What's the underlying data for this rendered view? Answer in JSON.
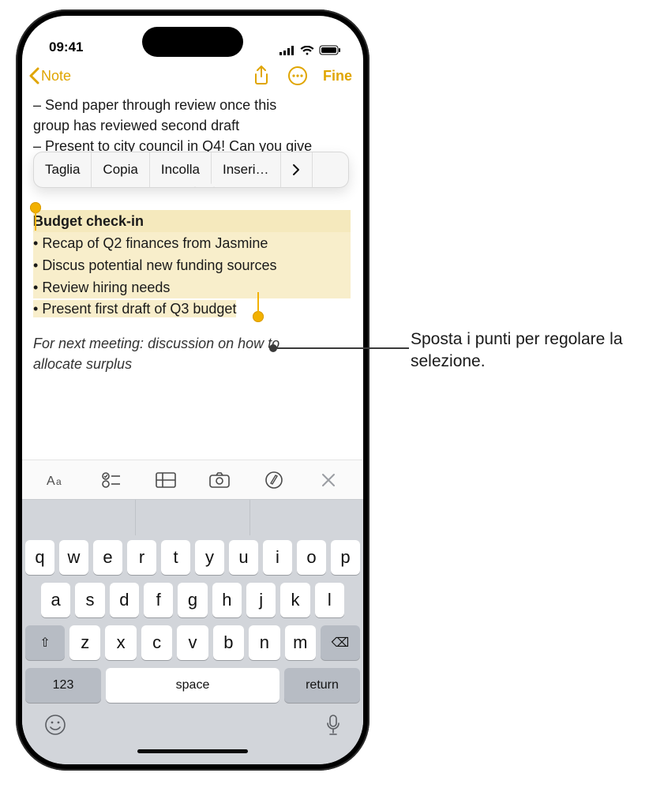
{
  "statusbar": {
    "time": "09:41"
  },
  "navbar": {
    "back_label": "Note",
    "done_label": "Fine"
  },
  "note": {
    "pre_lines": [
      "– Send paper through review once this",
      "group has reviewed second draft",
      "– Present to city council in Q4! Can you give"
    ],
    "selection": {
      "heading": "Budget check-in",
      "items": [
        "Recap of Q2 finances from Jasmine",
        "Discus potential new funding sources",
        "Review hiring needs",
        "Present first draft of Q3 budget"
      ]
    },
    "post_italic": [
      "For next meeting: discussion on how to",
      "allocate surplus"
    ]
  },
  "edit_menu": {
    "items": [
      "Taglia",
      "Copia",
      "Incolla",
      "Inseri…"
    ]
  },
  "kb_toolbar": {
    "icons": [
      "text-format",
      "checklist",
      "table",
      "camera",
      "markup",
      "close"
    ]
  },
  "keyboard": {
    "row1": [
      "q",
      "w",
      "e",
      "r",
      "t",
      "y",
      "u",
      "i",
      "o",
      "p"
    ],
    "row2": [
      "a",
      "s",
      "d",
      "f",
      "g",
      "h",
      "j",
      "k",
      "l"
    ],
    "row3": [
      "z",
      "x",
      "c",
      "v",
      "b",
      "n",
      "m"
    ],
    "shift_label": "⇧",
    "backspace_label": "⌫",
    "num_label": "123",
    "space_label": "space",
    "return_label": "return"
  },
  "callout": {
    "text": "Sposta i punti per regolare la selezione."
  }
}
